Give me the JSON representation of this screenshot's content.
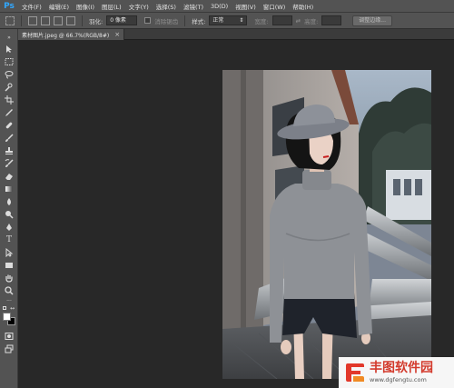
{
  "app": {
    "logo": "Ps"
  },
  "menu": [
    "文件(F)",
    "编辑(E)",
    "图像(I)",
    "图层(L)",
    "文字(Y)",
    "选择(S)",
    "滤镜(T)",
    "3D(D)",
    "视图(V)",
    "窗口(W)",
    "帮助(H)"
  ],
  "options": {
    "feather_label": "羽化:",
    "feather_value": "0 像素",
    "antialias_label": "消除锯齿",
    "style_label": "样式:",
    "style_value": "正常",
    "width_label": "宽度:",
    "height_label": "高度:",
    "refine_button": "调整边缘..."
  },
  "document": {
    "tab_title": "素材图片.jpeg @ 66.7%(RGB/8#)",
    "close_symbol": "×"
  },
  "toolbar": {
    "icons": [
      "move-icon",
      "marquee-icon",
      "lasso-icon",
      "quick-select-icon",
      "crop-icon",
      "eyedropper-icon",
      "healing-brush-icon",
      "brush-icon",
      "clone-stamp-icon",
      "history-brush-icon",
      "eraser-icon",
      "gradient-icon",
      "blur-icon",
      "dodge-icon",
      "pen-icon",
      "type-icon",
      "path-select-icon",
      "shape-icon",
      "hand-icon",
      "zoom-icon"
    ]
  },
  "colors": {
    "foreground": "#ffffff",
    "background": "#000000",
    "ui_panel": "#535353",
    "workspace": "#282828",
    "accent": "#31a8ff"
  },
  "watermark": {
    "name": "丰图软件园",
    "url": "www.dgfengtu.com"
  }
}
